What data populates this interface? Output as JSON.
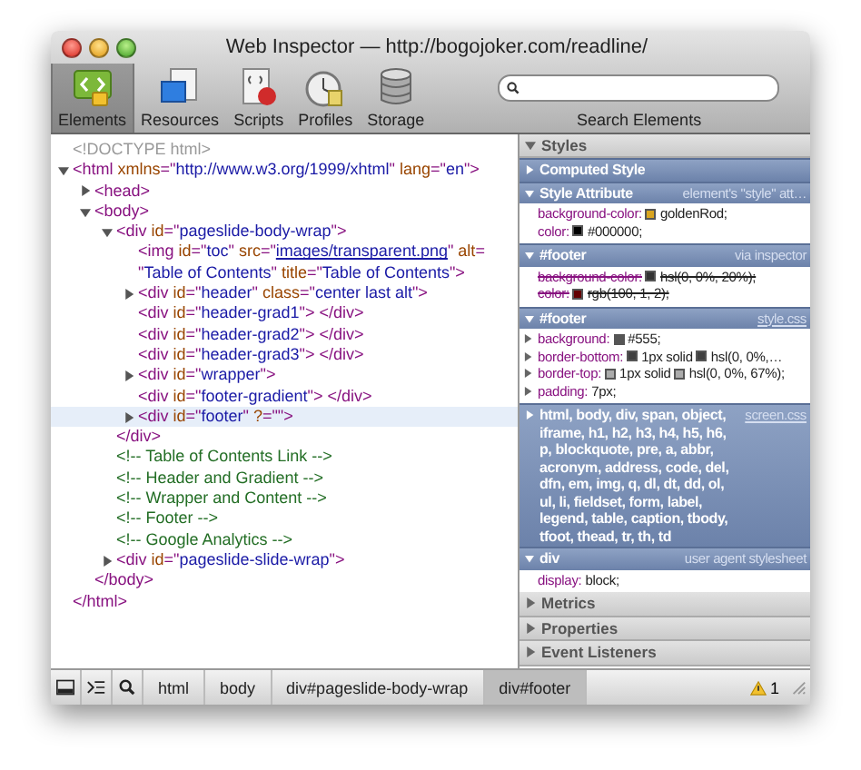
{
  "window": {
    "title": "Web Inspector — http://bogojoker.com/readline/"
  },
  "toolbar": {
    "tabs": [
      {
        "label": "Elements",
        "selected": true
      },
      {
        "label": "Resources",
        "selected": false
      },
      {
        "label": "Scripts",
        "selected": false
      },
      {
        "label": "Profiles",
        "selected": false
      },
      {
        "label": "Storage",
        "selected": false
      }
    ],
    "search": {
      "label": "Search Elements"
    }
  },
  "dom_tree": [
    {
      "tokens": [
        {
          "kind": "doctype",
          "text": "<!DOCTYPE html>"
        }
      ],
      "selected": false
    },
    {
      "tokens": [
        {
          "kind": "tag",
          "text": "<html "
        },
        {
          "kind": "attr",
          "text": "xmlns"
        },
        {
          "kind": "tag",
          "text": "=\""
        },
        {
          "kind": "value",
          "text": "http://www.w3.org/1999/xhtml"
        },
        {
          "kind": "tag",
          "text": "\" "
        },
        {
          "kind": "attr",
          "text": "lang"
        },
        {
          "kind": "tag",
          "text": "=\""
        },
        {
          "kind": "value",
          "text": "en"
        },
        {
          "kind": "tag",
          "text": "\">"
        }
      ],
      "expanded": true,
      "selected": false,
      "close": [
        {
          "kind": "tag",
          "text": "</html>"
        }
      ],
      "children": [
        {
          "tokens": [
            {
              "kind": "tag",
              "text": "<head>"
            }
          ],
          "expanded": false,
          "selected": false
        },
        {
          "tokens": [
            {
              "kind": "tag",
              "text": "<body>"
            }
          ],
          "expanded": true,
          "selected": false,
          "close": [
            {
              "kind": "tag",
              "text": "</body>"
            }
          ],
          "children": [
            {
              "tokens": [
                {
                  "kind": "tag",
                  "text": "<div "
                },
                {
                  "kind": "attr",
                  "text": "id"
                },
                {
                  "kind": "tag",
                  "text": "=\""
                },
                {
                  "kind": "value",
                  "text": "pageslide-body-wrap"
                },
                {
                  "kind": "tag",
                  "text": "\">"
                }
              ],
              "expanded": true,
              "selected": false,
              "close": [
                {
                  "kind": "tag",
                  "text": "</div>"
                }
              ],
              "children": [
                {
                  "tokens": [
                    {
                      "kind": "tag",
                      "text": "<img "
                    },
                    {
                      "kind": "attr",
                      "text": "id"
                    },
                    {
                      "kind": "tag",
                      "text": "=\""
                    },
                    {
                      "kind": "value",
                      "text": "toc"
                    },
                    {
                      "kind": "tag",
                      "text": "\" "
                    },
                    {
                      "kind": "attr",
                      "text": "src"
                    },
                    {
                      "kind": "tag",
                      "text": "=\""
                    },
                    {
                      "kind": "link",
                      "text": "images/transparent.png"
                    },
                    {
                      "kind": "tag",
                      "text": "\" "
                    },
                    {
                      "kind": "attr",
                      "text": "alt"
                    },
                    {
                      "kind": "tag",
                      "text": "= \""
                    },
                    {
                      "kind": "value",
                      "text": "Table of Contents"
                    },
                    {
                      "kind": "tag",
                      "text": "\" "
                    },
                    {
                      "kind": "attr",
                      "text": "title"
                    },
                    {
                      "kind": "tag",
                      "text": "=\""
                    },
                    {
                      "kind": "value",
                      "text": "Table of Contents"
                    },
                    {
                      "kind": "tag",
                      "text": "\">"
                    }
                  ],
                  "selected": false
                },
                {
                  "tokens": [
                    {
                      "kind": "tag",
                      "text": "<div "
                    },
                    {
                      "kind": "attr",
                      "text": "id"
                    },
                    {
                      "kind": "tag",
                      "text": "=\""
                    },
                    {
                      "kind": "value",
                      "text": "header"
                    },
                    {
                      "kind": "tag",
                      "text": "\" "
                    },
                    {
                      "kind": "attr",
                      "text": "class"
                    },
                    {
                      "kind": "tag",
                      "text": "=\""
                    },
                    {
                      "kind": "value",
                      "text": "center last alt"
                    },
                    {
                      "kind": "tag",
                      "text": "\">"
                    }
                  ],
                  "expanded": false,
                  "selected": false
                },
                {
                  "tokens": [
                    {
                      "kind": "tag",
                      "text": "<div "
                    },
                    {
                      "kind": "attr",
                      "text": "id"
                    },
                    {
                      "kind": "tag",
                      "text": "=\""
                    },
                    {
                      "kind": "value",
                      "text": "header-grad1"
                    },
                    {
                      "kind": "tag",
                      "text": "\"> </div>"
                    }
                  ],
                  "selected": false
                },
                {
                  "tokens": [
                    {
                      "kind": "tag",
                      "text": "<div "
                    },
                    {
                      "kind": "attr",
                      "text": "id"
                    },
                    {
                      "kind": "tag",
                      "text": "=\""
                    },
                    {
                      "kind": "value",
                      "text": "header-grad2"
                    },
                    {
                      "kind": "tag",
                      "text": "\"> </div>"
                    }
                  ],
                  "selected": false
                },
                {
                  "tokens": [
                    {
                      "kind": "tag",
                      "text": "<div "
                    },
                    {
                      "kind": "attr",
                      "text": "id"
                    },
                    {
                      "kind": "tag",
                      "text": "=\""
                    },
                    {
                      "kind": "value",
                      "text": "header-grad3"
                    },
                    {
                      "kind": "tag",
                      "text": "\"> </div>"
                    }
                  ],
                  "selected": false
                },
                {
                  "tokens": [
                    {
                      "kind": "tag",
                      "text": "<div "
                    },
                    {
                      "kind": "attr",
                      "text": "id"
                    },
                    {
                      "kind": "tag",
                      "text": "=\""
                    },
                    {
                      "kind": "value",
                      "text": "wrapper"
                    },
                    {
                      "kind": "tag",
                      "text": "\">"
                    }
                  ],
                  "expanded": false,
                  "selected": false
                },
                {
                  "tokens": [
                    {
                      "kind": "tag",
                      "text": "<div "
                    },
                    {
                      "kind": "attr",
                      "text": "id"
                    },
                    {
                      "kind": "tag",
                      "text": "=\""
                    },
                    {
                      "kind": "value",
                      "text": "footer-gradient"
                    },
                    {
                      "kind": "tag",
                      "text": "\"> </div>"
                    }
                  ],
                  "selected": false
                },
                {
                  "tokens": [
                    {
                      "kind": "tag",
                      "text": "<div "
                    },
                    {
                      "kind": "attr",
                      "text": "id"
                    },
                    {
                      "kind": "tag",
                      "text": "=\""
                    },
                    {
                      "kind": "value",
                      "text": "footer"
                    },
                    {
                      "kind": "tag",
                      "text": "\" "
                    },
                    {
                      "kind": "attr",
                      "text": "?"
                    },
                    {
                      "kind": "tag",
                      "text": "=\"\">"
                    }
                  ],
                  "expanded": false,
                  "selected": true
                }
              ]
            },
            {
              "tokens": [
                {
                  "kind": "comment",
                  "text": "<!-- Table of Contents Link -->"
                }
              ],
              "selected": false
            },
            {
              "tokens": [
                {
                  "kind": "comment",
                  "text": "<!-- Header and Gradient -->"
                }
              ],
              "selected": false
            },
            {
              "tokens": [
                {
                  "kind": "comment",
                  "text": "<!-- Wrapper and Content -->"
                }
              ],
              "selected": false
            },
            {
              "tokens": [
                {
                  "kind": "comment",
                  "text": "<!-- Footer -->"
                }
              ],
              "selected": false
            },
            {
              "tokens": [
                {
                  "kind": "comment",
                  "text": "<!-- Google Analytics -->"
                }
              ],
              "selected": false
            },
            {
              "tokens": [
                {
                  "kind": "tag",
                  "text": "<div "
                },
                {
                  "kind": "attr",
                  "text": "id"
                },
                {
                  "kind": "tag",
                  "text": "=\""
                },
                {
                  "kind": "value",
                  "text": "pageslide-slide-wrap"
                },
                {
                  "kind": "tag",
                  "text": "\">"
                }
              ],
              "expanded": false,
              "selected": false
            }
          ]
        }
      ]
    }
  ],
  "styles": {
    "title": "Styles",
    "expanded": true,
    "sections": [
      {
        "title": "Computed Style",
        "expanded": false
      },
      {
        "title": "Style Attribute",
        "source": "element's \"style\" att…",
        "source_is_link": false,
        "expanded": true,
        "properties": [
          {
            "name": "background-color:",
            "value": "goldenRod;",
            "color": "#daa520",
            "struck": false
          },
          {
            "name": "color:",
            "value": "#000000;",
            "color": "#000000",
            "struck": false
          }
        ]
      },
      {
        "title": "#footer",
        "source": "via inspector",
        "source_is_link": false,
        "expanded": true,
        "properties": [
          {
            "name": "background-color:",
            "value": "hsl(0, 0%, 20%);",
            "color": "#333333",
            "struck": true
          },
          {
            "name": "color:",
            "value": "rgb(100, 1, 2);",
            "color": "#640102",
            "struck": true
          }
        ]
      },
      {
        "title": "#footer",
        "source": "style.css",
        "source_is_link": true,
        "expanded": true,
        "properties": [
          {
            "name": "background:",
            "value": "#555;",
            "color": "#555555",
            "struck": false,
            "expanded": false
          },
          {
            "name": "border-bottom:",
            "value": "1px solid",
            "color": "#404040",
            "after": "hsl(0, 0%,…",
            "struck": false,
            "expanded": false
          },
          {
            "name": "border-top:",
            "value": "1px solid",
            "color": "#ababab",
            "after": "hsl(0, 0%, 67%);",
            "struck": false,
            "expanded": false
          },
          {
            "name": "padding:",
            "value": "7px;",
            "struck": false,
            "expanded": false
          }
        ]
      },
      {
        "title": "html, body, div, span, object, iframe, h1, h2, h3, h4, h5, h6, p, blockquote, pre, a, abbr, acronym, address, code, del, dfn, em, img, q, dl, dt, dd, ol, ul, li, fieldset, form, label, legend, table, caption, tbody, tfoot, thead, tr, th, td",
        "source": "screen.css",
        "source_is_link": true,
        "expanded": false
      },
      {
        "title": "div",
        "source": "user agent stylesheet",
        "source_is_link": false,
        "expanded": true,
        "properties": [
          {
            "name": "display:",
            "value": "block;",
            "struck": false
          }
        ]
      }
    ]
  },
  "panes": [
    {
      "title": "Metrics",
      "expanded": false
    },
    {
      "title": "Properties",
      "expanded": false
    },
    {
      "title": "Event Listeners",
      "expanded": false
    }
  ],
  "status_bar": {
    "breadcrumbs": [
      {
        "label": "html",
        "selected": false
      },
      {
        "label": "body",
        "selected": false
      },
      {
        "label": "div#pageslide-body-wrap",
        "selected": false
      },
      {
        "label": "div#footer",
        "selected": true
      }
    ],
    "warnings": "1"
  }
}
